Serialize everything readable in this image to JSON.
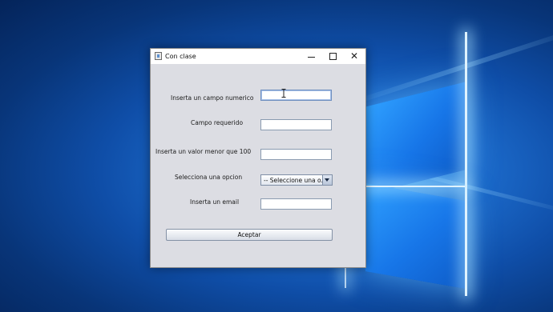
{
  "window": {
    "title": "Con clase",
    "controls": {
      "minimize_icon": "minimize-icon",
      "maximize_icon": "maximize-icon",
      "close_icon": "close-icon",
      "close_glyph": "✕"
    }
  },
  "form": {
    "fields": [
      {
        "label": "Inserta un campo numerico",
        "value": ""
      },
      {
        "label": "Campo requerido",
        "value": ""
      },
      {
        "label": "Inserta un valor menor que 100",
        "value": ""
      },
      {
        "label": "Selecciona una opcion",
        "selected": "-- Seleccione una o..."
      },
      {
        "label": "Inserta un email",
        "value": ""
      }
    ],
    "submit_label": "Aceptar"
  },
  "colors": {
    "window_bg": "#dcdde3",
    "desktop_accent": "#1e6fd0"
  }
}
